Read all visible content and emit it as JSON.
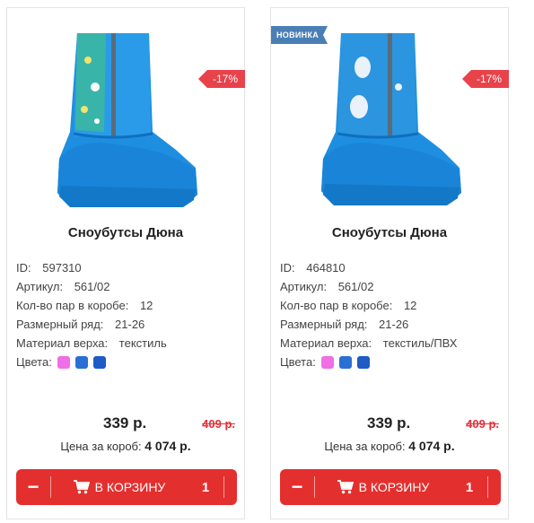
{
  "products": [
    {
      "title": "Сноубутсы Дюна",
      "badge_new": "",
      "discount": "-17%",
      "image_icon": "boot-image",
      "specs": {
        "id_label": "ID:",
        "id_value": "597310",
        "article_label": "Артикул:",
        "article_value": "561/02",
        "pairs_label": "Кол-во пар в коробе:",
        "pairs_value": "12",
        "size_label": "Размерный ряд:",
        "size_value": "21-26",
        "material_label": "Материал верха:",
        "material_value": "текстиль",
        "colors_label": "Цвета:"
      },
      "colors": [
        "#f06ee6",
        "#2a6fd6",
        "#1e5bc4"
      ],
      "price": "339 р.",
      "old_price": "409 р.",
      "box_price_label": "Цена за короб:",
      "box_price_value": "4 074 р.",
      "cart": {
        "minus": "−",
        "add_label": "В КОРЗИНУ",
        "qty": "1"
      }
    },
    {
      "title": "Сноубутсы Дюна",
      "badge_new": "НОВИНКА",
      "discount": "-17%",
      "image_icon": "boot-image",
      "specs": {
        "id_label": "ID:",
        "id_value": "464810",
        "article_label": "Артикул:",
        "article_value": "561/02",
        "pairs_label": "Кол-во пар в коробе:",
        "pairs_value": "12",
        "size_label": "Размерный ряд:",
        "size_value": "21-26",
        "material_label": "Материал верха:",
        "material_value": "текстиль/ПВХ",
        "colors_label": "Цвета:"
      },
      "colors": [
        "#f06ee6",
        "#2a6fd6",
        "#1e5bc4"
      ],
      "price": "339 р.",
      "old_price": "409 р.",
      "box_price_label": "Цена за короб:",
      "box_price_value": "4 074 р.",
      "cart": {
        "minus": "−",
        "add_label": "В КОРЗИНУ",
        "qty": "1"
      }
    }
  ],
  "theme": {
    "accent": "#e42f2f",
    "discount": "#e8424a",
    "badge_new": "#4a7fb5",
    "boot_blue": "#1e8fe0"
  }
}
